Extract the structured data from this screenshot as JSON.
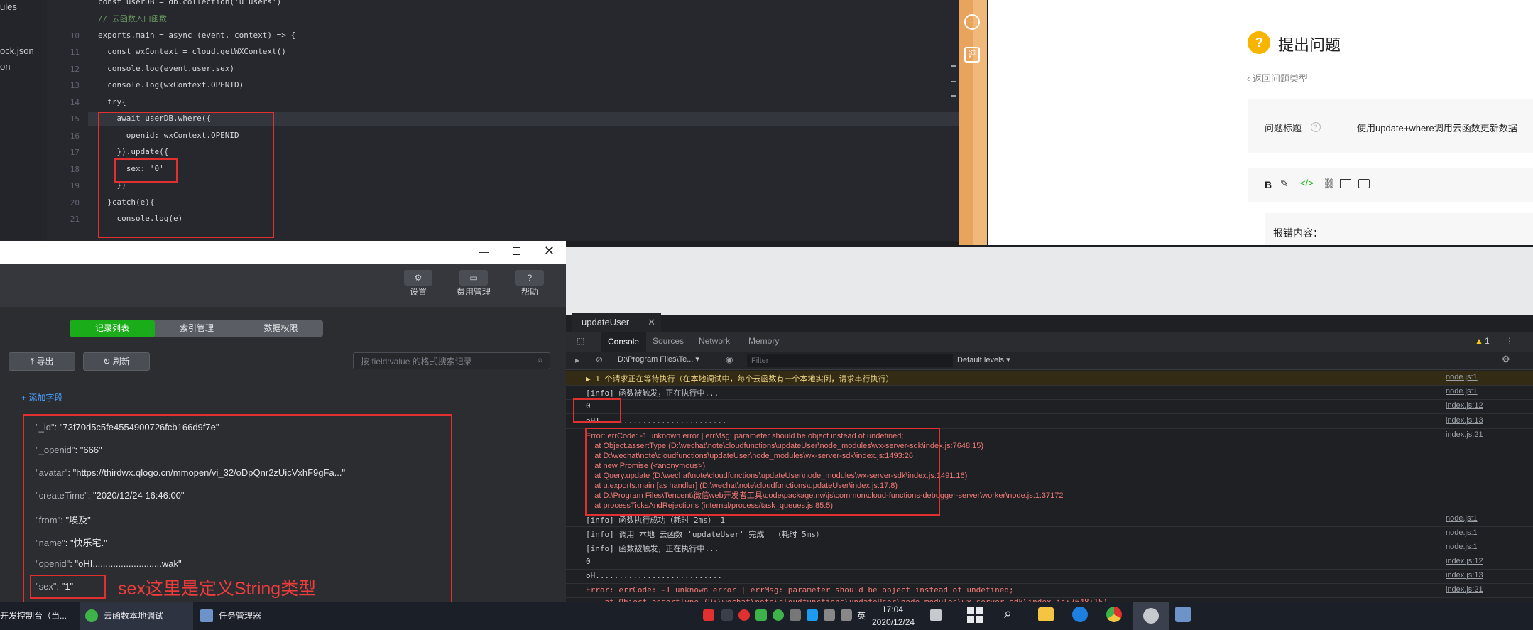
{
  "editor": {
    "sidebar_items": [
      "ules",
      "ock.json",
      "on"
    ],
    "lines": [
      {
        "no": "",
        "text": "const userDB = db.collection('u_users')"
      },
      {
        "no": "",
        "text": "// 云函数入口函数"
      },
      {
        "no": "10",
        "text": "exports.main = async (event, context) => {"
      },
      {
        "no": "11",
        "text": "  const wxContext = cloud.getWXContext()"
      },
      {
        "no": "12",
        "text": "  console.log(event.user.sex)"
      },
      {
        "no": "13",
        "text": "  console.log(wxContext.OPENID)"
      },
      {
        "no": "14",
        "text": "  try{"
      },
      {
        "no": "15",
        "text": "    await userDB.where({"
      },
      {
        "no": "16",
        "text": "      openid: wxContext.OPENID"
      },
      {
        "no": "17",
        "text": "    }).update({"
      },
      {
        "no": "18",
        "text": "      sex: '0'"
      },
      {
        "no": "19",
        "text": "    })"
      },
      {
        "no": "20",
        "text": "  }catch(e){"
      },
      {
        "no": "21",
        "text": "    console.log(e)"
      }
    ]
  },
  "web": {
    "title": "提出问题",
    "back_link": "返回问题类型",
    "field_label": "问题标题",
    "field_value": "使用update+where调用云函数更新数据",
    "editor_content": "报错内容："
  },
  "db": {
    "toolbar": {
      "settings": "设置",
      "billing": "费用管理",
      "help": "帮助"
    },
    "tabs": [
      "记录列表",
      "索引管理",
      "数据权限"
    ],
    "export_label": "导出",
    "refresh_label": "刷新",
    "search_placeholder": "按 field:value 的格式搜索记录",
    "add_field": "添加字段",
    "record": [
      {
        "key": "\"_id\"",
        "value": "\"73f70d5c5fe4554900726fcb166d9f7e\""
      },
      {
        "key": "\"_openid\"",
        "value": "\"666\""
      },
      {
        "key": "\"avatar\"",
        "value": "\"https://thirdwx.qlogo.cn/mmopen/vi_32/oDpQnr2zUicVxhF9gFa...\""
      },
      {
        "key": "\"createTime\"",
        "value": "\"2020/12/24 16:46:00\""
      },
      {
        "key": "\"from\"",
        "value": "\"埃及\""
      },
      {
        "key": "\"name\"",
        "value": "\"快乐宅.\""
      },
      {
        "key": "\"openid\"",
        "value": "\"oHI...........................wak\""
      },
      {
        "key": "\"sex\"",
        "value": "\"1\""
      }
    ],
    "annotation": "sex这里是定义String类型"
  },
  "console": {
    "tab_title": "updateUser",
    "tabs": [
      "Console",
      "Sources",
      "Network",
      "Memory"
    ],
    "context": "D:\\Program Files\\Te...",
    "filter_placeholder": "Filter",
    "levels": "Default levels",
    "warning_count": "1",
    "rows": [
      {
        "text": "▶ 1 个请求正在等待执行（在本地调试中，每个云函数有一个本地实例，请求串行执行）",
        "src": "node.js:1",
        "warn": true
      },
      {
        "text": "[info] 函数被触发，正在执行中...",
        "src": "node.js:1"
      },
      {
        "text": "0",
        "src": "index.js:12"
      },
      {
        "text": "oHI...........................",
        "src": "index.js:13"
      }
    ],
    "error_lines": [
      "Error: errCode: -1 unknown error | errMsg: parameter should be object instead of undefined;",
      "    at Object.assertType (D:\\wechat\\note\\cloudfunctions\\updateUser\\node_modules\\wx-server-sdk\\index.js:7648:15)",
      "    at D:\\wechat\\note\\cloudfunctions\\updateUser\\node_modules\\wx-server-sdk\\index.js:1493:26",
      "    at new Promise (<anonymous>)",
      "    at Query.update (D:\\wechat\\note\\cloudfunctions\\updateUser\\node_modules\\wx-server-sdk\\index.js:1491:16)",
      "    at u.exports.main [as handler] (D:\\wechat\\note\\cloudfunctions\\updateUser\\index.js:17:8)",
      "    at D:\\Program Files\\Tencent\\微信web开发者工具\\code\\package.nw\\js\\common\\cloud-functions-debugger-server\\worker\\node.js:1:37172",
      "    at processTicksAndRejections (internal/process/task_queues.js:85:5)"
    ],
    "error_src": "index.js:21",
    "rows_after": [
      {
        "text": "[info] 函数执行成功（耗时 2ms） 1",
        "src": "node.js:1"
      },
      {
        "text": "[info] 调用 本地 云函数 'updateUser' 完成  （耗时 5ms）",
        "src": "node.js:1"
      },
      {
        "text": "[info] 函数被触发，正在执行中...",
        "src": "node.js:1"
      },
      {
        "text": "0",
        "src": "index.js:12"
      },
      {
        "text": "oH...........................",
        "src": "index.js:13"
      },
      {
        "text": "Error: errCode: -1 unknown error | errMsg: parameter should be object instead of undefined;",
        "src": "index.js:21",
        "err": true
      },
      {
        "text": "    at Object.assertType (D:\\wechat\\note\\cloudfunctions\\updateUser\\node_modules\\wx-server-sdk\\index.js:7648:15)",
        "src": "",
        "err": true
      }
    ]
  },
  "taskbar": {
    "items": [
      "开发控制台（当...",
      "云函数本地调试",
      "任务管理器"
    ],
    "ime": "英",
    "time": "17:04",
    "date": "2020/12/24"
  }
}
